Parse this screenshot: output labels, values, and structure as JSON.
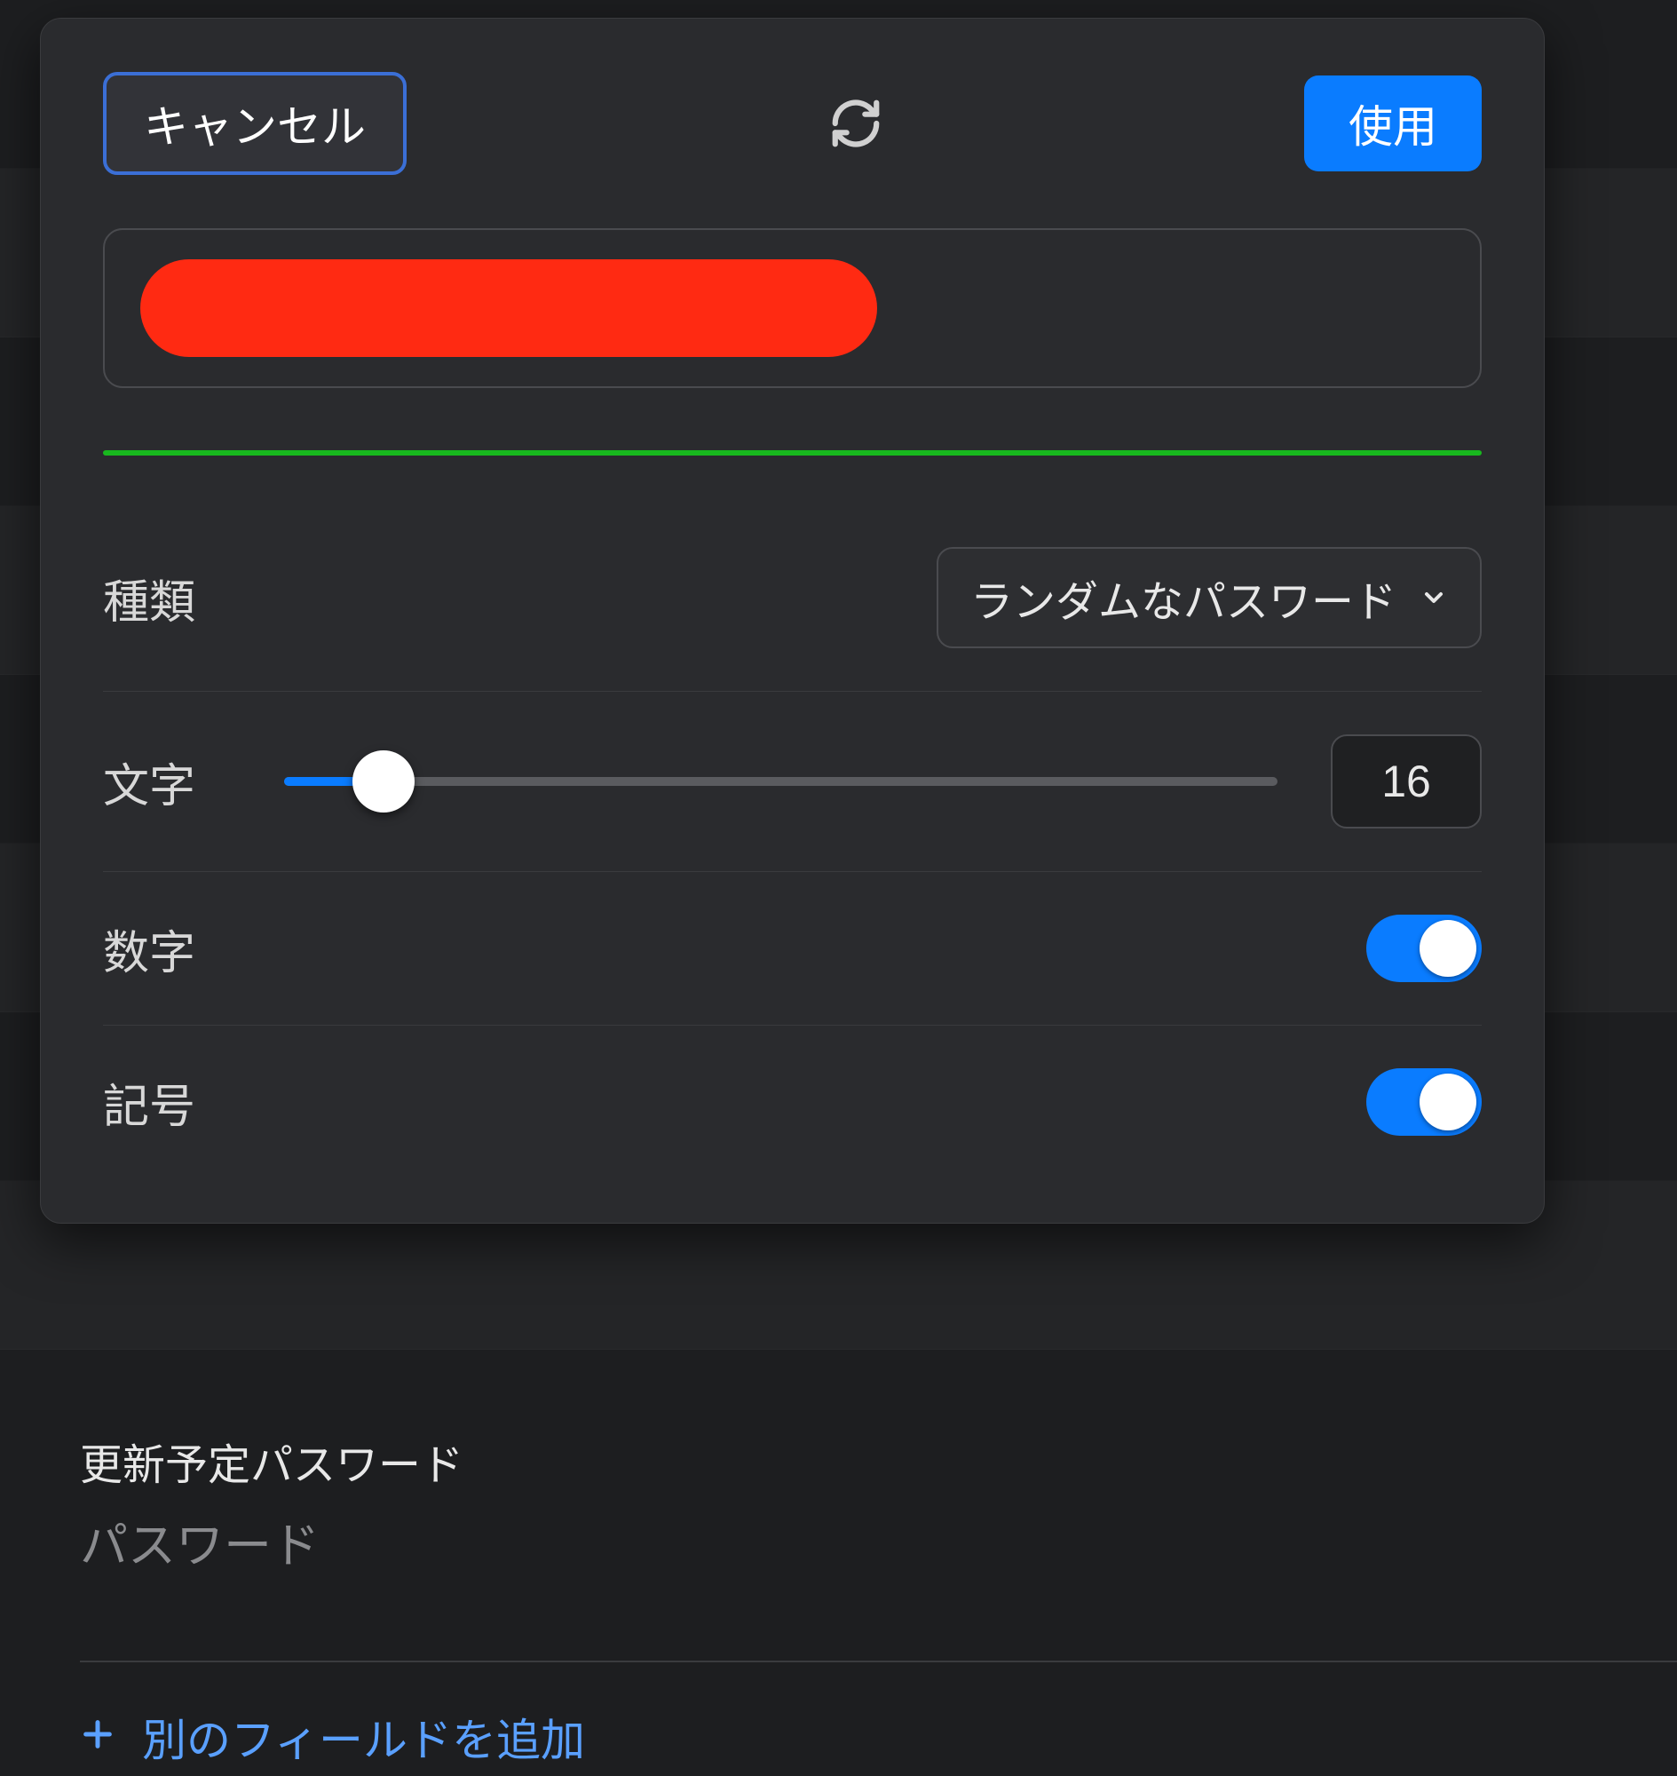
{
  "header": {
    "cancel_label": "キャンセル",
    "use_label": "使用"
  },
  "password": {
    "redacted": true
  },
  "options": {
    "type": {
      "label": "種類",
      "selected": "ランダムなパスワード"
    },
    "characters": {
      "label": "文字",
      "value": "16"
    },
    "numbers": {
      "label": "数字",
      "enabled": true
    },
    "symbols": {
      "label": "記号",
      "enabled": true
    }
  },
  "underlying": {
    "section_title": "更新予定パスワード",
    "section_sub": "パスワード",
    "add_field_label": "別のフィールドを追加"
  }
}
